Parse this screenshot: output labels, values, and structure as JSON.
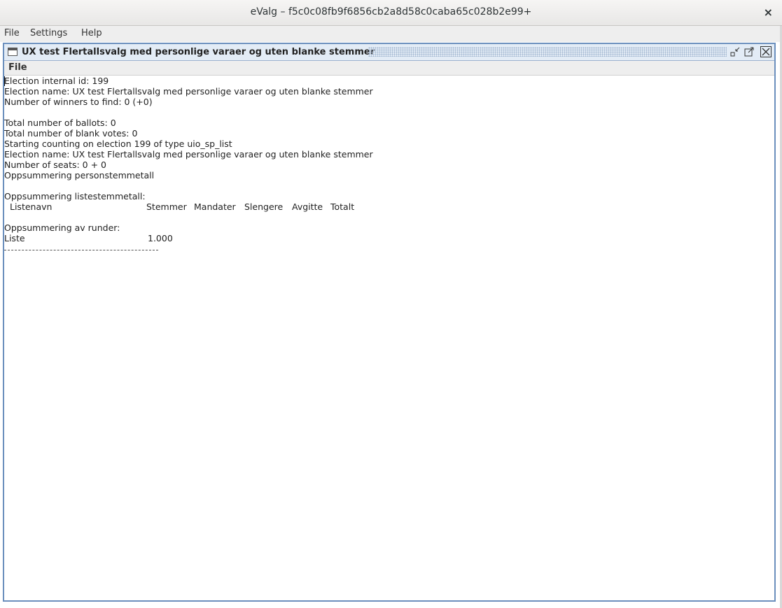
{
  "window": {
    "title": "eValg – f5c0c08fb9f6856cb2a8d58c0caba65c028b2e99+",
    "close_symbol": "×"
  },
  "menubar": [
    "File",
    "Settings",
    "Help"
  ],
  "internal_frame": {
    "title": "UX test Flertallsvalg med personlige varaer og uten blanke stemmer",
    "menu": [
      "File"
    ],
    "buttons": {
      "iconify": "iconify-icon",
      "maximize": "maximize-icon",
      "close": "close-icon"
    }
  },
  "output": {
    "lines": [
      "Election internal id: 199",
      "Election name: UX test Flertallsvalg med personlige varaer og uten blanke stemmer",
      "Number of winners to find: 0 (+0)",
      "",
      "Total number of ballots: 0",
      "Total number of blank votes: 0",
      "Starting counting on election 199 of type uio_sp_list",
      "Election name: UX test Flertallsvalg med personlige varaer og uten blanke stemmer",
      "Number of seats: 0 + 0",
      "Oppsummering personstemmetall",
      "",
      "Oppsummering listestemmetall:"
    ],
    "list_table_headers": [
      "Listenavn",
      "Stemmer",
      "Mandater",
      "Slengere",
      "Avgitte",
      "Totalt"
    ],
    "rounds_heading": "Oppsummering av runder:",
    "rounds_row": {
      "label": "Liste",
      "value": "1.000"
    }
  }
}
